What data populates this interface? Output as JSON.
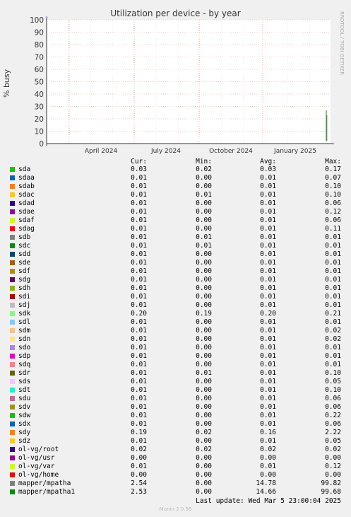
{
  "chart_data": {
    "type": "line",
    "title": "Utilization per device - by year",
    "ylabel": "% busy",
    "watermark": "RRDTOOL / TOBI OETIKER",
    "ylim": [
      0,
      100
    ],
    "yticks": [
      0,
      10,
      20,
      30,
      40,
      50,
      60,
      70,
      80,
      90,
      100
    ],
    "xticks": [
      "April 2024",
      "July 2024",
      "October 2024",
      "January 2025"
    ],
    "grid": true,
    "columns": [
      "Cur:",
      "Min:",
      "Avg:",
      "Max:"
    ],
    "series": [
      {
        "name": "sda",
        "color": "#00cc00",
        "cur": "0.03",
        "min": "0.02",
        "avg": "0.03",
        "max": "0.17"
      },
      {
        "name": "sdaa",
        "color": "#0066b3",
        "cur": "0.01",
        "min": "0.00",
        "avg": "0.01",
        "max": "0.07"
      },
      {
        "name": "sdab",
        "color": "#ff8000",
        "cur": "0.01",
        "min": "0.00",
        "avg": "0.01",
        "max": "0.10"
      },
      {
        "name": "sdac",
        "color": "#ffcc00",
        "cur": "0.01",
        "min": "0.01",
        "avg": "0.01",
        "max": "0.10"
      },
      {
        "name": "sdad",
        "color": "#330099",
        "cur": "0.01",
        "min": "0.00",
        "avg": "0.01",
        "max": "0.06"
      },
      {
        "name": "sdae",
        "color": "#990099",
        "cur": "0.01",
        "min": "0.00",
        "avg": "0.01",
        "max": "0.12"
      },
      {
        "name": "sdaf",
        "color": "#ccff00",
        "cur": "0.01",
        "min": "0.00",
        "avg": "0.01",
        "max": "0.06"
      },
      {
        "name": "sdag",
        "color": "#ff0000",
        "cur": "0.01",
        "min": "0.00",
        "avg": "0.01",
        "max": "0.11"
      },
      {
        "name": "sdb",
        "color": "#808080",
        "cur": "0.01",
        "min": "0.01",
        "avg": "0.01",
        "max": "0.01"
      },
      {
        "name": "sdc",
        "color": "#008f00",
        "cur": "0.01",
        "min": "0.01",
        "avg": "0.01",
        "max": "0.01"
      },
      {
        "name": "sdd",
        "color": "#00487d",
        "cur": "0.01",
        "min": "0.00",
        "avg": "0.01",
        "max": "0.01"
      },
      {
        "name": "sde",
        "color": "#b35a00",
        "cur": "0.01",
        "min": "0.00",
        "avg": "0.01",
        "max": "0.01"
      },
      {
        "name": "sdf",
        "color": "#b38f00",
        "cur": "0.01",
        "min": "0.00",
        "avg": "0.01",
        "max": "0.01"
      },
      {
        "name": "sdg",
        "color": "#6b006b",
        "cur": "0.01",
        "min": "0.00",
        "avg": "0.01",
        "max": "0.01"
      },
      {
        "name": "sdh",
        "color": "#8fb300",
        "cur": "0.01",
        "min": "0.00",
        "avg": "0.01",
        "max": "0.01"
      },
      {
        "name": "sdi",
        "color": "#b30000",
        "cur": "0.01",
        "min": "0.00",
        "avg": "0.01",
        "max": "0.01"
      },
      {
        "name": "sdj",
        "color": "#bebebe",
        "cur": "0.01",
        "min": "0.00",
        "avg": "0.01",
        "max": "0.01"
      },
      {
        "name": "sdk",
        "color": "#80ff80",
        "cur": "0.20",
        "min": "0.19",
        "avg": "0.20",
        "max": "0.21"
      },
      {
        "name": "sdl",
        "color": "#80c9ff",
        "cur": "0.01",
        "min": "0.00",
        "avg": "0.01",
        "max": "0.01"
      },
      {
        "name": "sdm",
        "color": "#ffc080",
        "cur": "0.01",
        "min": "0.00",
        "avg": "0.01",
        "max": "0.02"
      },
      {
        "name": "sdn",
        "color": "#ffe680",
        "cur": "0.01",
        "min": "0.00",
        "avg": "0.01",
        "max": "0.02"
      },
      {
        "name": "sdo",
        "color": "#aa80ff",
        "cur": "0.01",
        "min": "0.00",
        "avg": "0.01",
        "max": "0.01"
      },
      {
        "name": "sdp",
        "color": "#ee00cc",
        "cur": "0.01",
        "min": "0.00",
        "avg": "0.01",
        "max": "0.01"
      },
      {
        "name": "sdq",
        "color": "#ff8080",
        "cur": "0.01",
        "min": "0.00",
        "avg": "0.01",
        "max": "0.01"
      },
      {
        "name": "sdr",
        "color": "#666600",
        "cur": "0.01",
        "min": "0.01",
        "avg": "0.01",
        "max": "0.10"
      },
      {
        "name": "sds",
        "color": "#ffbfff",
        "cur": "0.01",
        "min": "0.00",
        "avg": "0.01",
        "max": "0.05"
      },
      {
        "name": "sdt",
        "color": "#00ffcc",
        "cur": "0.01",
        "min": "0.00",
        "avg": "0.01",
        "max": "0.10"
      },
      {
        "name": "sdu",
        "color": "#cc6699",
        "cur": "0.01",
        "min": "0.00",
        "avg": "0.01",
        "max": "0.06"
      },
      {
        "name": "sdv",
        "color": "#999900",
        "cur": "0.01",
        "min": "0.00",
        "avg": "0.01",
        "max": "0.06"
      },
      {
        "name": "sdw",
        "color": "#00cc00",
        "cur": "0.01",
        "min": "0.00",
        "avg": "0.01",
        "max": "0.22"
      },
      {
        "name": "sdx",
        "color": "#0066b3",
        "cur": "0.01",
        "min": "0.00",
        "avg": "0.01",
        "max": "0.06"
      },
      {
        "name": "sdy",
        "color": "#ff8000",
        "cur": "0.19",
        "min": "0.02",
        "avg": "0.16",
        "max": "2.22"
      },
      {
        "name": "sdz",
        "color": "#ffcc00",
        "cur": "0.01",
        "min": "0.00",
        "avg": "0.01",
        "max": "0.05"
      },
      {
        "name": "ol-vg/root",
        "color": "#330099",
        "cur": "0.02",
        "min": "0.02",
        "avg": "0.02",
        "max": "0.02"
      },
      {
        "name": "ol-vg/usr",
        "color": "#990099",
        "cur": "0.00",
        "min": "0.00",
        "avg": "0.00",
        "max": "0.00"
      },
      {
        "name": "ol-vg/var",
        "color": "#ccff00",
        "cur": "0.01",
        "min": "0.00",
        "avg": "0.01",
        "max": "0.12"
      },
      {
        "name": "ol-vg/home",
        "color": "#ff0000",
        "cur": "0.00",
        "min": "0.00",
        "avg": "0.00",
        "max": "0.00"
      },
      {
        "name": "mapper/mpatha",
        "color": "#808080",
        "cur": "2.54",
        "min": "0.00",
        "avg": "14.78",
        "max": "99.82"
      },
      {
        "name": "mapper/mpatha1",
        "color": "#008f00",
        "cur": "2.53",
        "min": "0.00",
        "avg": "14.66",
        "max": "99.68"
      }
    ],
    "spike": {
      "series": "mapper/mpatha1",
      "x_fraction": 0.985,
      "y_top": 27,
      "y_bottom": 2
    }
  },
  "last_update": "Last update: Wed Mar  5 23:00:04 2025",
  "footer": "Munin 2.0.56"
}
